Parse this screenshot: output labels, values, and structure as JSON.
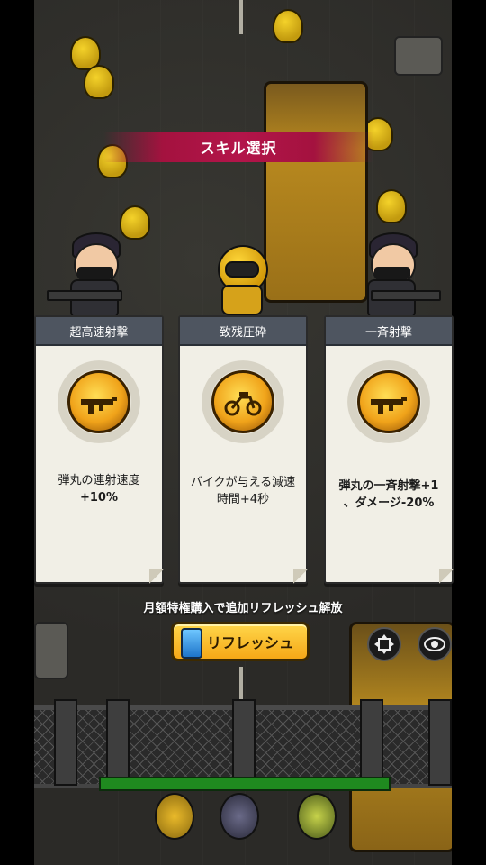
{
  "banner": {
    "title": "スキル選択"
  },
  "cards": [
    {
      "title": "超高速射撃",
      "icon": "rifle-icon",
      "desc_line1": "弾丸の連射速度",
      "desc_line2": "+10%"
    },
    {
      "title": "致残圧砕",
      "icon": "motorbike-icon",
      "desc_line1": "バイクが与える減速",
      "desc_line2": "時間+4秒"
    },
    {
      "title": "一斉射撃",
      "icon": "rifle-icon",
      "desc_line1": "弾丸の一斉射撃+1",
      "desc_line2": "、ダメージ-20%"
    }
  ],
  "promo": {
    "text": "月額特権購入で追加リフレッシュ解放"
  },
  "refresh": {
    "label": "リフレッシュ",
    "icon": "card-refresh-icon"
  },
  "controls": {
    "speed_icon": "speed-toggle-icon",
    "view_icon": "eye-icon"
  },
  "colors": {
    "banner": "#b3154a",
    "button": "#f5a817",
    "card_header": "#4e5560",
    "hp_bar": "#1f8a1f"
  }
}
